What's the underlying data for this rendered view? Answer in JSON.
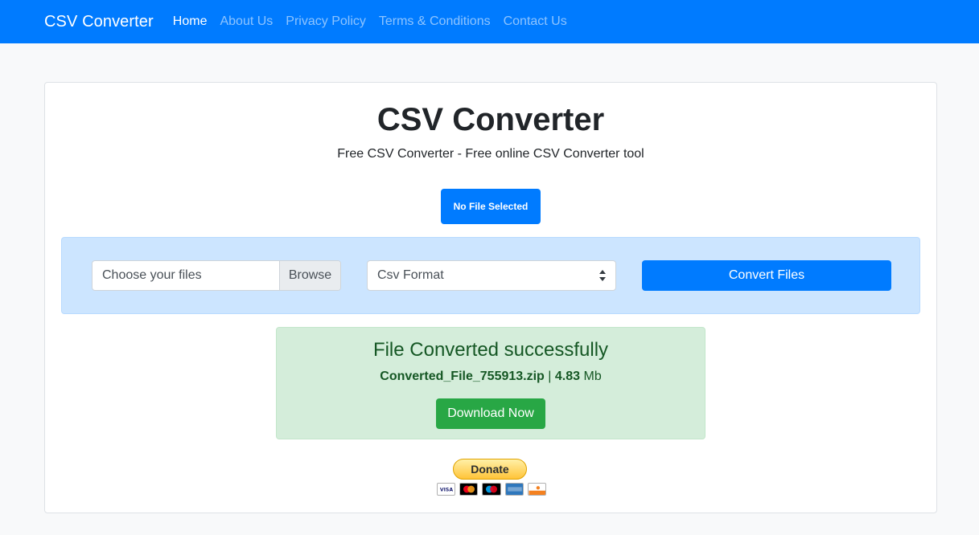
{
  "navbar": {
    "brand": "CSV Converter",
    "links": [
      "Home",
      "About Us",
      "Privacy Policy",
      "Terms & Conditions",
      "Contact Us"
    ],
    "active": "Home",
    "color": "#007bff"
  },
  "main": {
    "title": "CSV Converter",
    "subtitle": "Free CSV Converter - Free online CSV Converter tool",
    "file_status": "No File Selected"
  },
  "form": {
    "file_placeholder": "Choose your files",
    "browse_label": "Browse",
    "format_selected": "Csv Format",
    "convert_label": "Convert Files"
  },
  "result": {
    "title": "File Converted successfully",
    "file_name": "Converted_File_755913.zip",
    "separator": "|",
    "size_value": "4.83",
    "size_unit": "Mb",
    "download_label": "Download Now",
    "color": "#28a745"
  },
  "donate": {
    "label": "Donate",
    "cards": [
      "visa-icon",
      "mastercard-icon",
      "maestro-icon",
      "amex-icon",
      "discover-icon"
    ]
  }
}
